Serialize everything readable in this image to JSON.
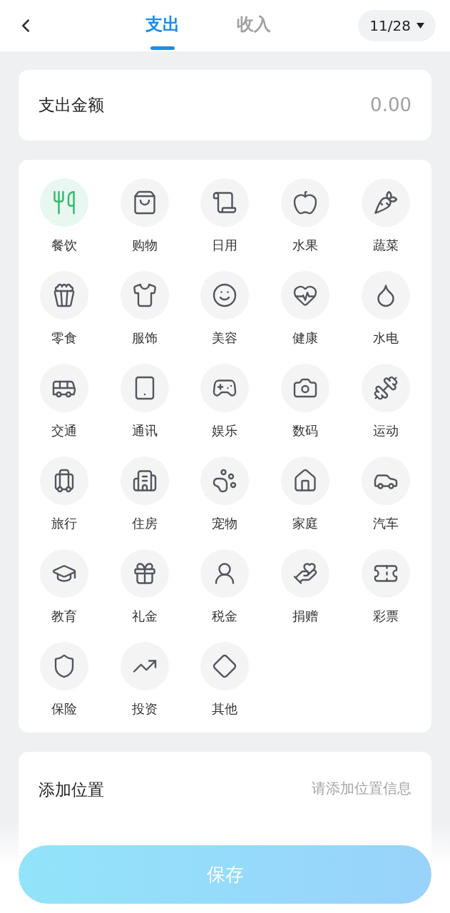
{
  "header": {
    "tabs": [
      {
        "label": "支出",
        "selected": true
      },
      {
        "label": "收入",
        "selected": false
      }
    ],
    "date": "11/28"
  },
  "amount": {
    "label": "支出金额",
    "placeholder": "0.00"
  },
  "categories": [
    {
      "label": "餐饮",
      "selected": true
    },
    {
      "label": "购物",
      "selected": false
    },
    {
      "label": "日用",
      "selected": false
    },
    {
      "label": "水果",
      "selected": false
    },
    {
      "label": "蔬菜",
      "selected": false
    },
    {
      "label": "零食",
      "selected": false
    },
    {
      "label": "服饰",
      "selected": false
    },
    {
      "label": "美容",
      "selected": false
    },
    {
      "label": "健康",
      "selected": false
    },
    {
      "label": "水电",
      "selected": false
    },
    {
      "label": "交通",
      "selected": false
    },
    {
      "label": "通讯",
      "selected": false
    },
    {
      "label": "娱乐",
      "selected": false
    },
    {
      "label": "数码",
      "selected": false
    },
    {
      "label": "运动",
      "selected": false
    },
    {
      "label": "旅行",
      "selected": false
    },
    {
      "label": "住房",
      "selected": false
    },
    {
      "label": "宠物",
      "selected": false
    },
    {
      "label": "家庭",
      "selected": false
    },
    {
      "label": "汽车",
      "selected": false
    },
    {
      "label": "教育",
      "selected": false
    },
    {
      "label": "礼金",
      "selected": false
    },
    {
      "label": "税金",
      "selected": false
    },
    {
      "label": "捐赠",
      "selected": false
    },
    {
      "label": "彩票",
      "selected": false
    },
    {
      "label": "保险",
      "selected": false
    },
    {
      "label": "投资",
      "selected": false
    },
    {
      "label": "其他",
      "selected": false
    }
  ],
  "location": {
    "label": "添加位置",
    "placeholder": "请添加位置信息"
  },
  "save_button": "保存"
}
